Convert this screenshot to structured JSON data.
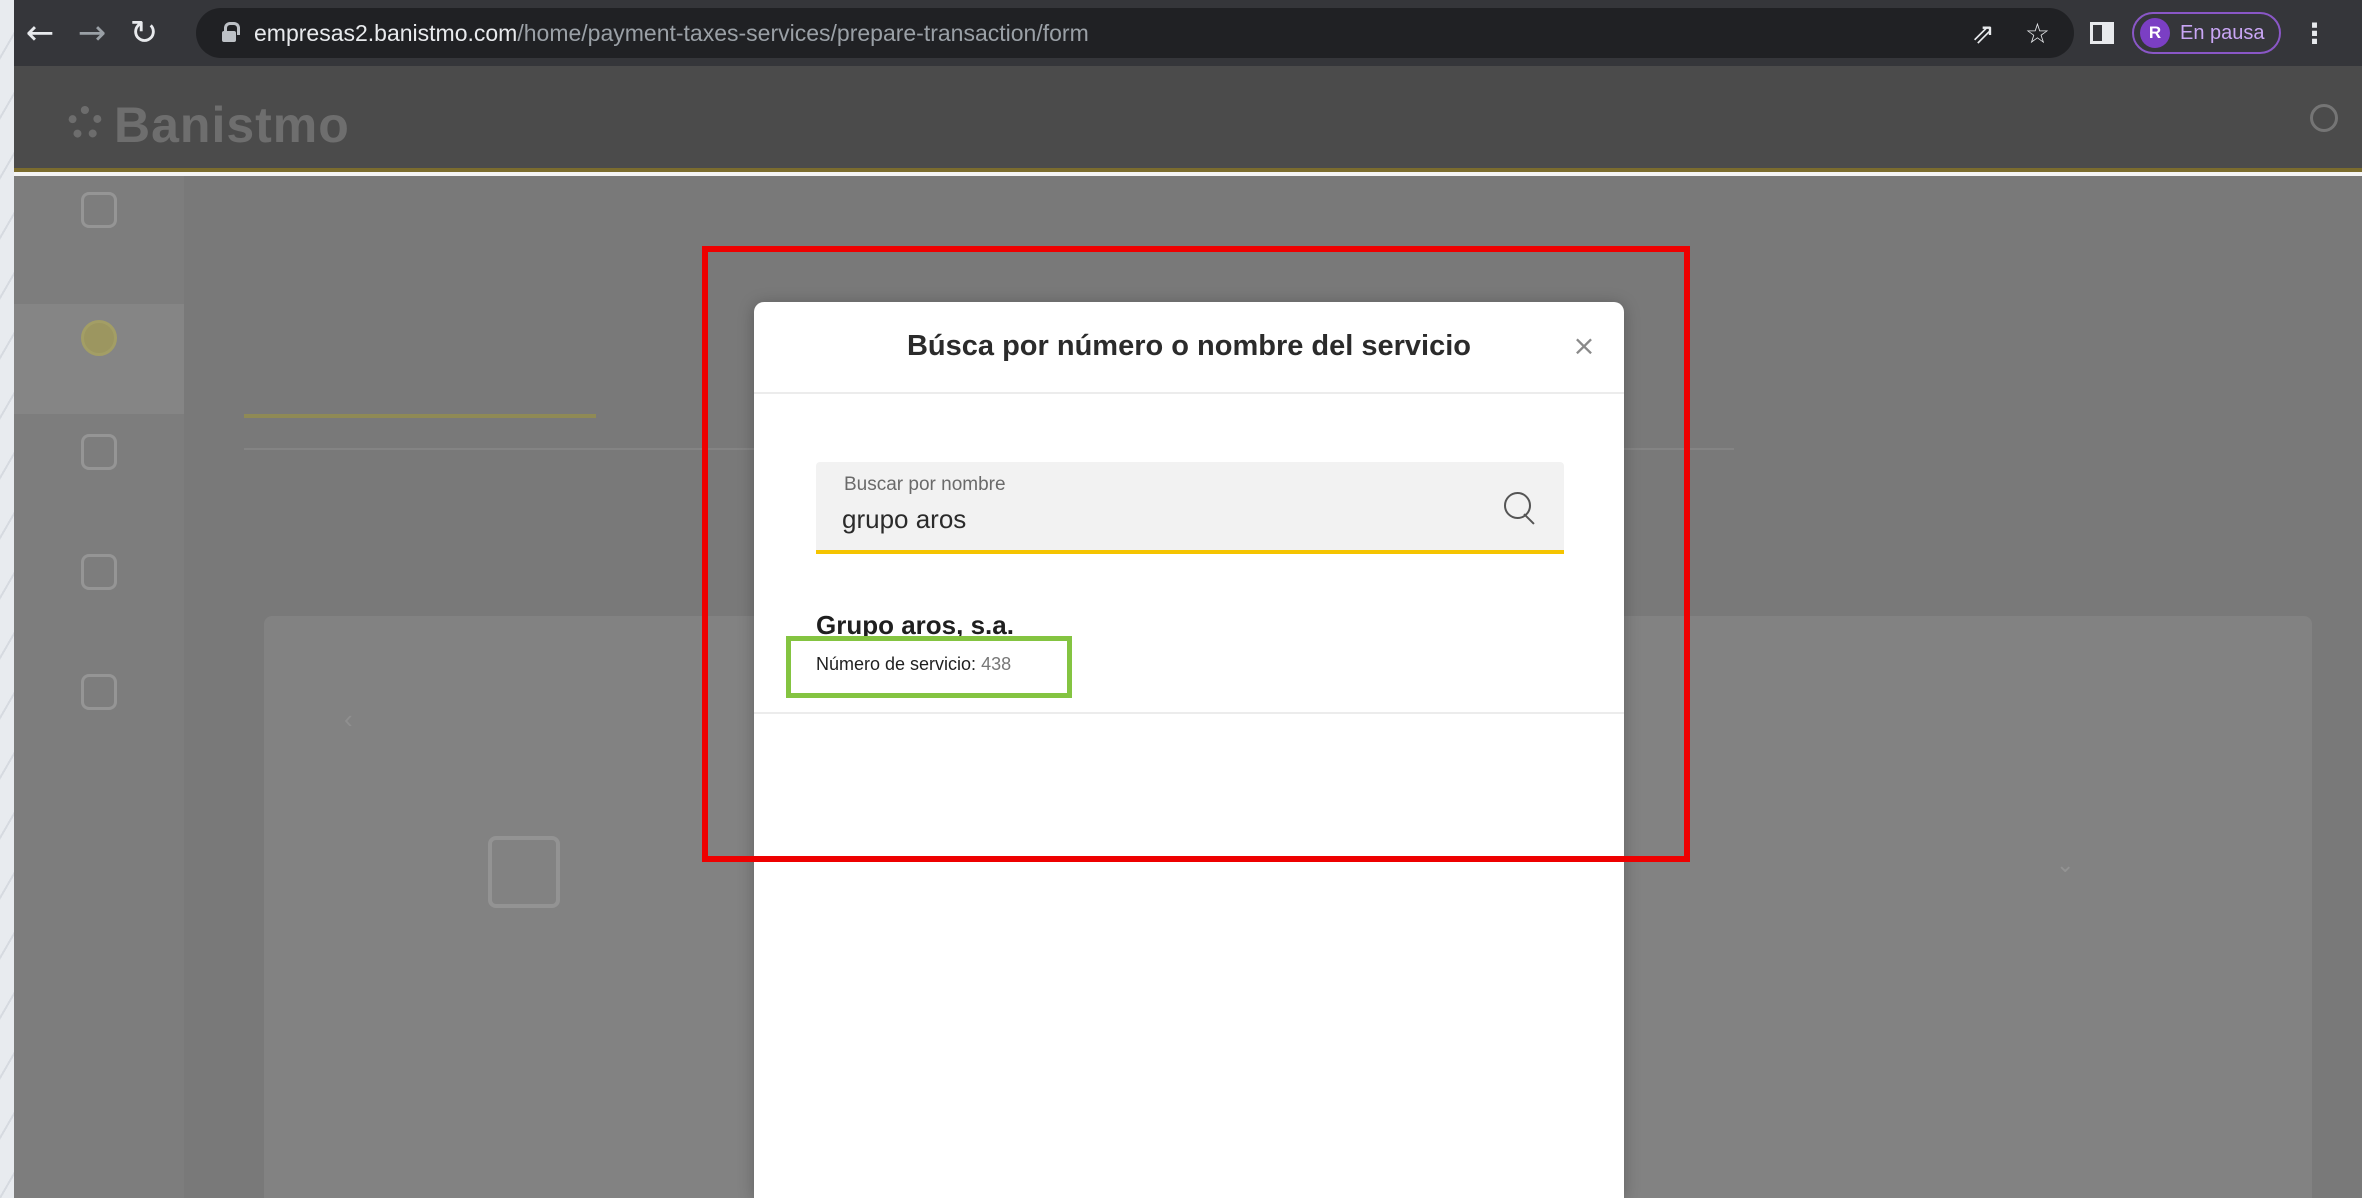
{
  "browser": {
    "url_domain": "empresas2.banistmo.com",
    "url_path": "/home/payment-taxes-services/prepare-transaction/form",
    "profile_initial": "R",
    "profile_status": "En pausa"
  },
  "modal": {
    "title": "Búsca por número o nombre del servicio",
    "search": {
      "label": "Buscar por nombre",
      "value": "grupo aros"
    },
    "results": [
      {
        "name": "Grupo aros, s.a.",
        "number_label": "Número de servicio:",
        "number_value": "438"
      }
    ]
  },
  "colors": {
    "accent_yellow": "#f5c400",
    "highlight_red": "#ee0000",
    "highlight_green": "#84c441"
  }
}
